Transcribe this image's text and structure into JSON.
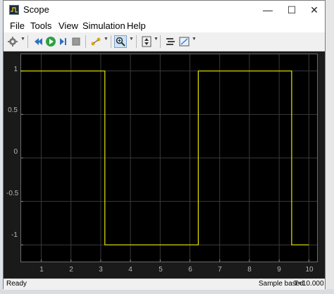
{
  "window": {
    "title": "Scope",
    "controls": {
      "minimize": "—",
      "maximize": "☐",
      "close": "✕"
    }
  },
  "menu": [
    "File",
    "Tools",
    "View",
    "Simulation",
    "Help"
  ],
  "toolbar": {
    "items": [
      {
        "name": "settings-icon",
        "glyph": "⚙"
      },
      {
        "name": "step-back-icon",
        "glyph": "◀"
      },
      {
        "name": "run-icon",
        "glyph": "▶"
      },
      {
        "name": "step-forward-icon",
        "glyph": "▶"
      },
      {
        "name": "stop-icon",
        "glyph": "■"
      },
      {
        "name": "highlight-icon",
        "glyph": "✎"
      },
      {
        "name": "zoom-icon",
        "glyph": "🔍"
      },
      {
        "name": "fit-axes-icon",
        "glyph": "⇕"
      },
      {
        "name": "measure-icon",
        "glyph": "≡"
      },
      {
        "name": "style-icon",
        "glyph": "▤"
      }
    ]
  },
  "plot": {
    "background": "#000000",
    "trace_color": "#e6e600",
    "grid_color": "#3a3a3a"
  },
  "chart_data": {
    "type": "line",
    "xlim": [
      0.3,
      10.3
    ],
    "ylim": [
      -1.2,
      1.2
    ],
    "x_ticks": [
      "1",
      "2",
      "3",
      "4",
      "5",
      "6",
      "7",
      "8",
      "9",
      "10"
    ],
    "y_ticks": [
      "1",
      "0.5",
      "0",
      "-0.5",
      "-1"
    ],
    "grid": true,
    "series": [
      {
        "x": [
          0.3,
          3.14,
          3.14,
          6.28,
          6.28,
          9.42,
          9.42,
          10.0
        ],
        "y": [
          1,
          1,
          -1,
          -1,
          1,
          1,
          -1,
          -1
        ]
      }
    ]
  },
  "status": {
    "left": "Ready",
    "mode": "Sample based",
    "time": "T=10.000"
  }
}
